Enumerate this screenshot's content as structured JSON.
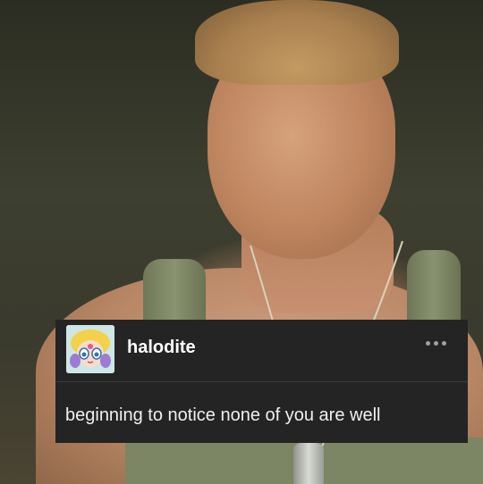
{
  "post": {
    "username": "halodite",
    "text": "beginning to notice none of you are well",
    "avatar_icon": "anime-avatar-icon",
    "menu_icon": "more-options-icon"
  },
  "colors": {
    "card_background": "#242424",
    "username": "#ffffff",
    "post_text": "#f0f0f0"
  }
}
